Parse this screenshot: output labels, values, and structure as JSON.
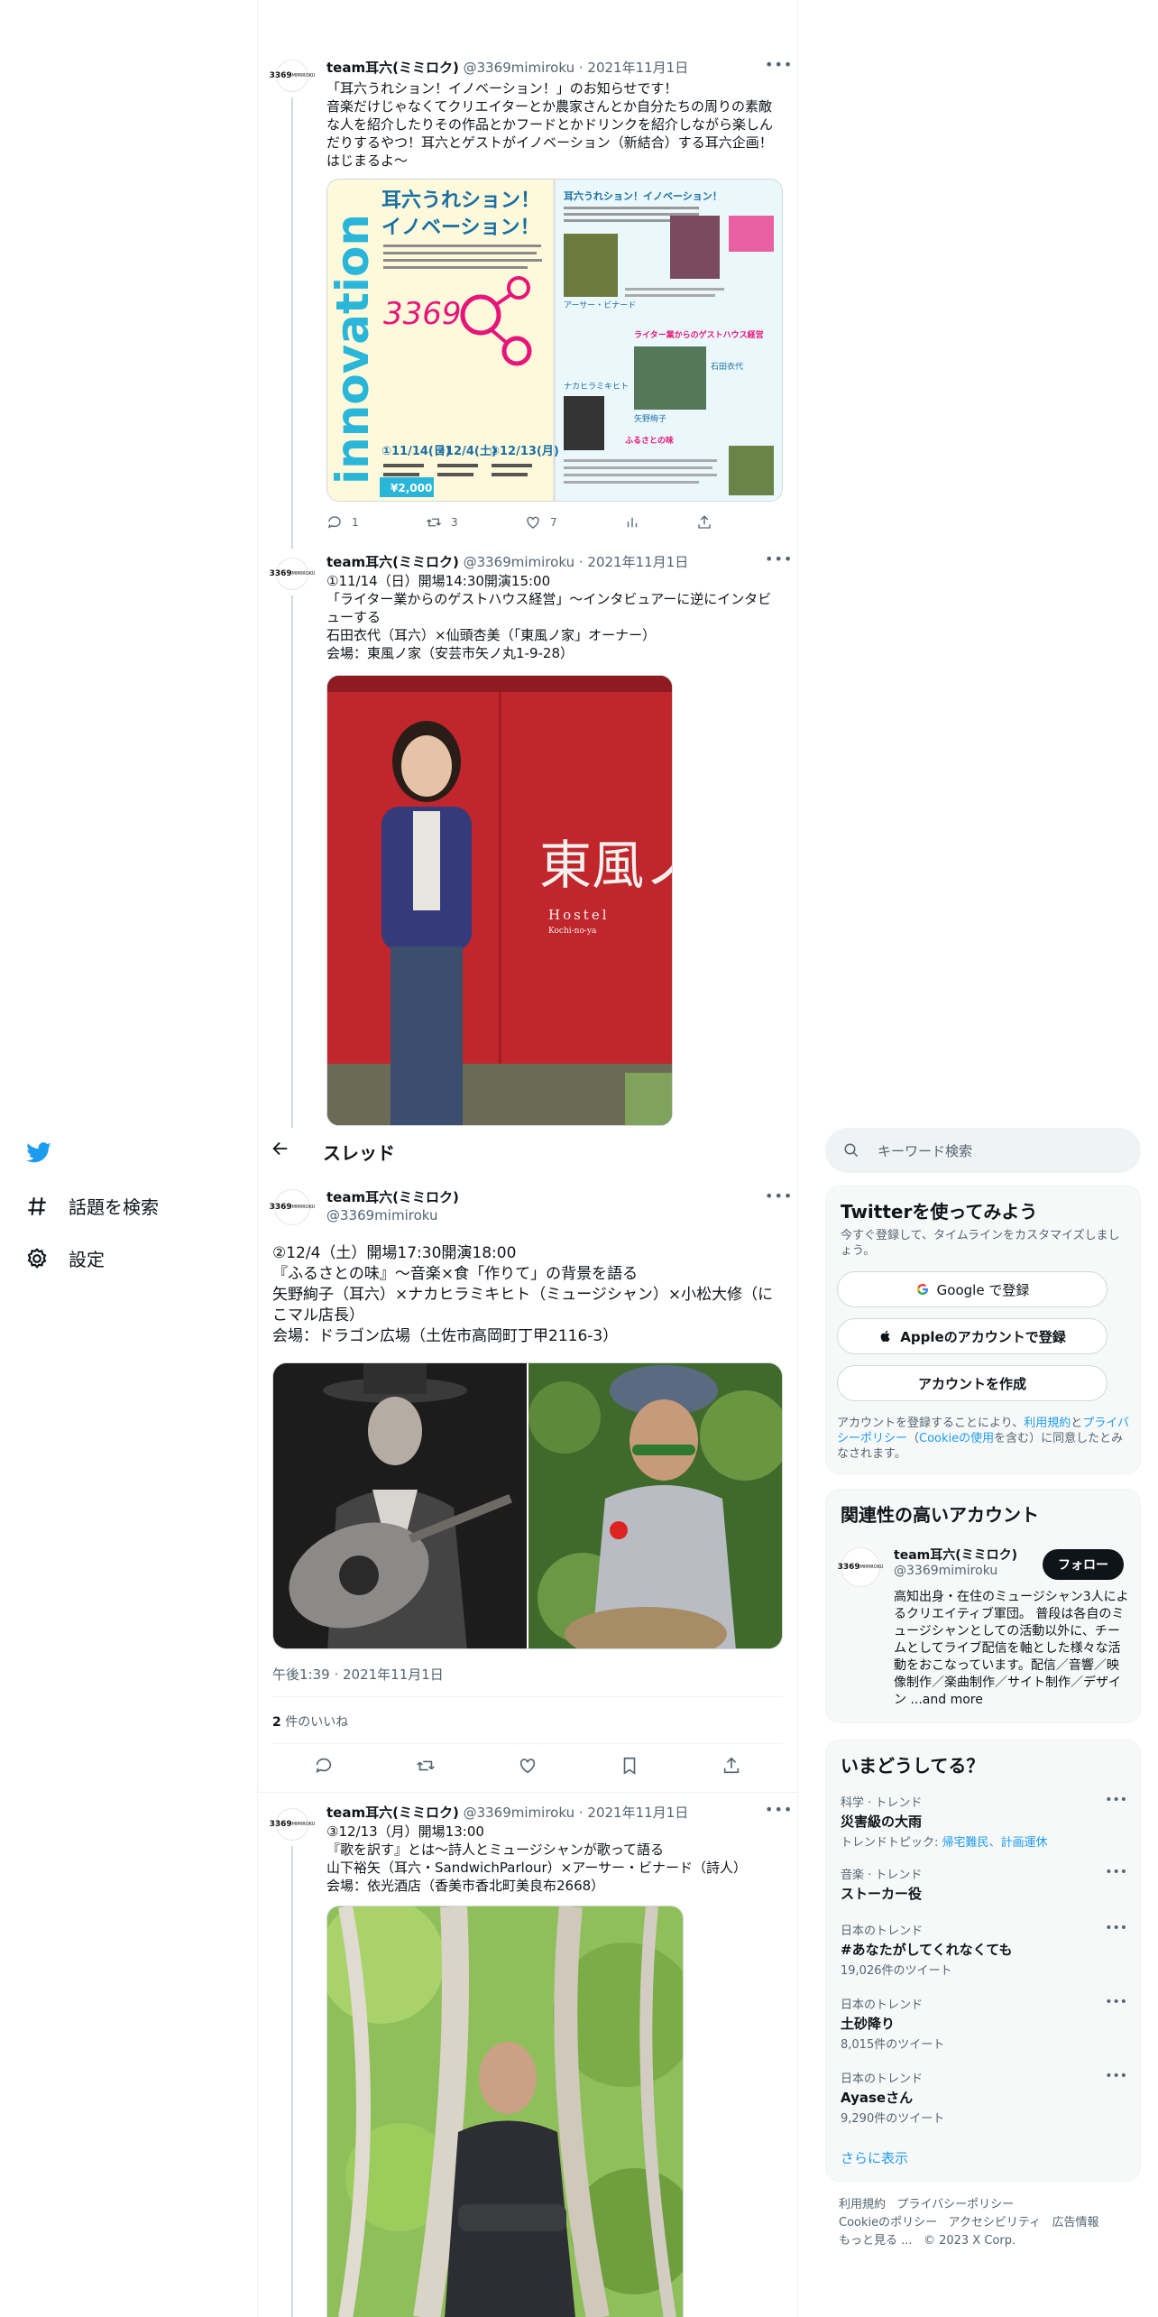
{
  "nav": {
    "explore_label": "話題を検索",
    "settings_label": "設定"
  },
  "header": {
    "title": "スレッド"
  },
  "tweets": {
    "t1": {
      "name": "team耳六(ミミロク)",
      "handle": "@3369mimiroku",
      "dot": "·",
      "date": "2021年11月1日",
      "text": "「耳六うれション！イノベーション！」のお知らせです！\n音楽だけじゃなくてクリエイターとか農家さんとか自分たちの周りの素敵な人を紹介したりその作品とかフードとかドリンクを紹介しながら楽しんだりするやつ！耳六とゲストがイノベーション（新結合）する耳六企画！はじまるよ〜",
      "poster": {
        "title1": "耳六うれション！",
        "title2": "イノベーション！",
        "vertical": "innovation",
        "right_title": "耳六うれション！イノベーション！",
        "logo": "3369",
        "dates": [
          "①11/14(日)",
          "②12/4(土)",
          "③12/13(月)"
        ],
        "price": "¥2,000",
        "tags": [
          "ライター業からのゲストハウス経営",
          "ふるさとの味",
          "アーサー・ビナード",
          "ナカヒラミキヒト",
          "石田衣代",
          "矢野絢子"
        ]
      },
      "replies": "1",
      "retweets": "3",
      "likes": "7"
    },
    "t2": {
      "name": "team耳六(ミミロク)",
      "handle": "@3369mimiroku",
      "dot": "·",
      "date": "2021年11月1日",
      "text": "①11/14（日）開場14:30開演15:00\n「ライター業からのゲストハウス経営」～インタビュアーに逆にインタビューする\n石田衣代（耳六）×仙頭杏美（「東風ノ家」オーナー）\n会場：東風ノ家（安芸市矢ノ丸1-9-28）",
      "noren_text": "東風ノ家",
      "noren_sub": "Hostel",
      "noren_sub2": "Kochi-no-ya"
    },
    "main": {
      "name": "team耳六(ミミロク)",
      "handle": "@3369mimiroku",
      "text": "②12/4（土）開場17:30開演18:00\n『ふるさとの味』～音楽×食「作りて」の背景を語る\n矢野絢子（耳六）×ナカヒラミキヒト（ミュージシャン）×小松大修（にこマル店長）\n会場：ドラゴン広場（土佐市高岡町丁甲2116-3）",
      "timestamp": "午後1:39 · 2021年11月1日",
      "likes_count": "2",
      "likes_label": "件のいいね"
    },
    "t4": {
      "name": "team耳六(ミミロク)",
      "handle": "@3369mimiroku",
      "dot": "·",
      "date": "2021年11月1日",
      "text": "③12/13（月）開場13:00\n『歌を訳す』とは〜詩人とミュージシャンが歌って語る\n山下裕矢（耳六・SandwichParlour）×アーサー・ビナード（詩人）\n会場：依光酒店（香美市香北町美良布2668）"
    }
  },
  "sidebar": {
    "search_placeholder": "キーワード検索",
    "signup": {
      "title": "Twitterを使ってみよう",
      "subtitle": "今すぐ登録して、タイムラインをカスタマイズしましょう。",
      "google": "Google で登録",
      "apple": "Appleのアカウントで登録",
      "create": "アカウントを作成",
      "legal_1": "アカウントを登録することにより、",
      "legal_terms": "利用規約",
      "legal_and": "と",
      "legal_privacy": "プライバシーポリシー",
      "legal_paren": "（",
      "legal_cookie": "Cookieの使用",
      "legal_2": "を含む）に同意したとみなされます。"
    },
    "related": {
      "title": "関連性の高いアカウント",
      "name": "team耳六(ミミロク)",
      "handle": "@3369mimiroku",
      "follow": "フォロー",
      "bio": "高知出身・在住のミュージシャン3人によるクリエイティブ軍団。 普段は各自のミュージシャンとしての活動以外に、チームとしてライブ配信を軸とした様々な活動をおこなっています。配信／音響／映像制作／楽曲制作／サイト制作／デザイン ...and more"
    },
    "trends": {
      "title": "いまどうしてる？",
      "items": [
        {
          "cat": "科学 · トレンド",
          "name": "災害級の大雨",
          "extra_label": "トレンドトピック: ",
          "extra_links": "帰宅難民、計画運休"
        },
        {
          "cat": "音楽 · トレンド",
          "name": "ストーカー役"
        },
        {
          "cat": "日本のトレンド",
          "name": "#あなたがしてくれなくても",
          "count": "19,026件のツイート"
        },
        {
          "cat": "日本のトレンド",
          "name": "土砂降り",
          "count": "8,015件のツイート"
        },
        {
          "cat": "日本のトレンド",
          "name": "Ayaseさん",
          "count": "9,290件のツイート"
        }
      ],
      "show_more": "さらに表示"
    },
    "footer": {
      "line1a": "利用規約",
      "line1b": "プライバシーポリシー",
      "line2a": "Cookieのポリシー",
      "line2b": "アクセシビリティ",
      "line2c": "広告情報",
      "line3a": "もっと見る ...",
      "line3b": "© 2023 X Corp."
    }
  },
  "colors": {
    "twitter_blue": "#1d9bf0",
    "text": "#0f1419",
    "muted": "#536471",
    "poster_cyan": "#29b6d8",
    "noren_red": "#c0262c"
  }
}
